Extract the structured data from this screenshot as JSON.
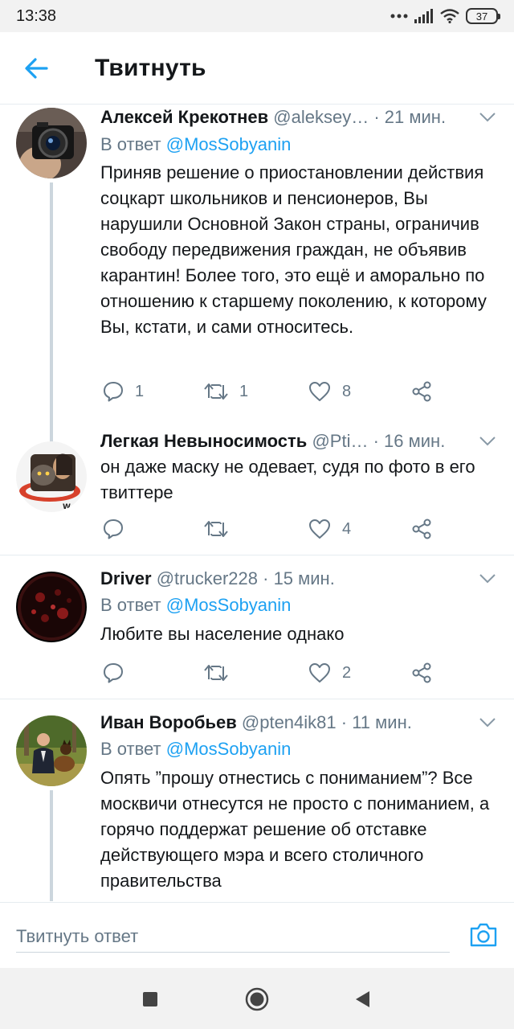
{
  "status_bar": {
    "time": "13:38",
    "battery": "37"
  },
  "header": {
    "title": "Твитнуть"
  },
  "tweets": [
    {
      "name": "Алексей Крекотнев",
      "handle": "@aleksey…",
      "time": "· 21 мин.",
      "reply_prefix": "В ответ",
      "reply_handle": "@MosSobyanin",
      "text": "Приняв решение о приостановлении действия соцкарт школьников и пенсионеров, Вы нарушили Основной Закон страны, ограничив свободу передвижения граждан, не объявив карантин! Более того, это ещё и аморально по отношению к старшему поколению, к которому Вы, кстати, и сами относитесь.",
      "replies": "1",
      "retweets": "1",
      "likes": "8"
    },
    {
      "name": "Легкая Невыносимость",
      "handle": "@Pti…",
      "time": "· 16 мин.",
      "text": "он даже маску не одевает, судя по фото в его твиттере",
      "replies": "",
      "retweets": "",
      "likes": "4"
    },
    {
      "name": "Driver",
      "handle": "@trucker228",
      "time": "· 15 мин.",
      "reply_prefix": "В ответ",
      "reply_handle": "@MosSobyanin",
      "text": "Любите вы население однако",
      "replies": "",
      "retweets": "",
      "likes": "2"
    },
    {
      "name": "Иван Воробьев",
      "handle": "@pten4ik81",
      "time": "· 11 мин.",
      "reply_prefix": "В ответ",
      "reply_handle": "@MosSobyanin",
      "text": "Опять ”прошу отнестись с пониманием”? Все москвичи отнесутся не просто с пониманием, а горячо поддержат решение об отставке действующего мэра и всего столичного правительства"
    }
  ],
  "compose": {
    "placeholder": "Твитнуть ответ"
  },
  "colors": {
    "accent": "#1da1f2",
    "secondary_text": "#657786",
    "primary_text": "#14171a"
  }
}
